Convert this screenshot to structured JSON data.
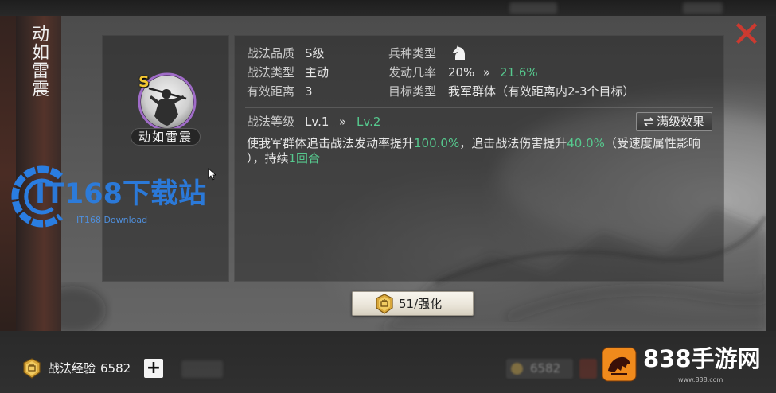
{
  "colors": {
    "accent_green": "#56c98e",
    "close_red": "#cc3a30",
    "grade_gold": "#f2c531",
    "portrait_ring": "#a06cc8",
    "label_text": "#cacaca",
    "value_text": "#e6e6e6",
    "watermark_blue": "#2a7de1",
    "logo_orange": "#f08a1c"
  },
  "modal": {
    "banner_title": "动如雷震",
    "close_icon": "close-icon"
  },
  "tactic": {
    "portrait_icon": "warrior-portrait",
    "grade_badge": "S",
    "portrait_name": "动如雷震",
    "quality": {
      "label": "战法品质",
      "value": "S级"
    },
    "troop_type": {
      "label": "兵种类型",
      "icon": "horse-icon"
    },
    "tactic_type": {
      "label": "战法类型",
      "value": "主动"
    },
    "trigger_rate": {
      "label": "发动几率",
      "value": "20%",
      "arrow": "»",
      "next_value": "21.6%"
    },
    "range": {
      "label": "有效距离",
      "value": "3"
    },
    "target": {
      "label": "目标类型",
      "value": "我军群体（有效距离内2-3个目标）"
    },
    "level": {
      "label": "战法等级",
      "value": "Lv.1",
      "arrow": "»",
      "next_value": "Lv.2"
    },
    "max_effect_button": {
      "label": "满级效果",
      "icon": "swap-arrows-icon"
    },
    "description_lines": [
      [
        {
          "text": "使我军群体追击战法发动率提升",
          "highlight": false
        },
        {
          "text": "100.0%",
          "highlight": true
        },
        {
          "text": "，追击战法伤害提升",
          "highlight": false
        },
        {
          "text": "40.0%",
          "highlight": true
        },
        {
          "text": "（受速度属性影响",
          "highlight": false
        }
      ],
      [
        {
          "text": "），持续",
          "highlight": false
        },
        {
          "text": "1回合",
          "highlight": true
        }
      ]
    ]
  },
  "upgrade_button": {
    "label": "51/强化",
    "icon": "tactic-emblem-icon"
  },
  "footer": {
    "exp_icon": "tactic-emblem-icon",
    "exp_label": "战法经验",
    "exp_value": "6582",
    "add_button_label": "+",
    "background_exp_value": "6582"
  },
  "watermarks": {
    "it168_title": "IT168下载站",
    "it168_subtitle": "IT168 Download",
    "site_838_name": "838手游网",
    "site_838_url": "www.838.com"
  }
}
